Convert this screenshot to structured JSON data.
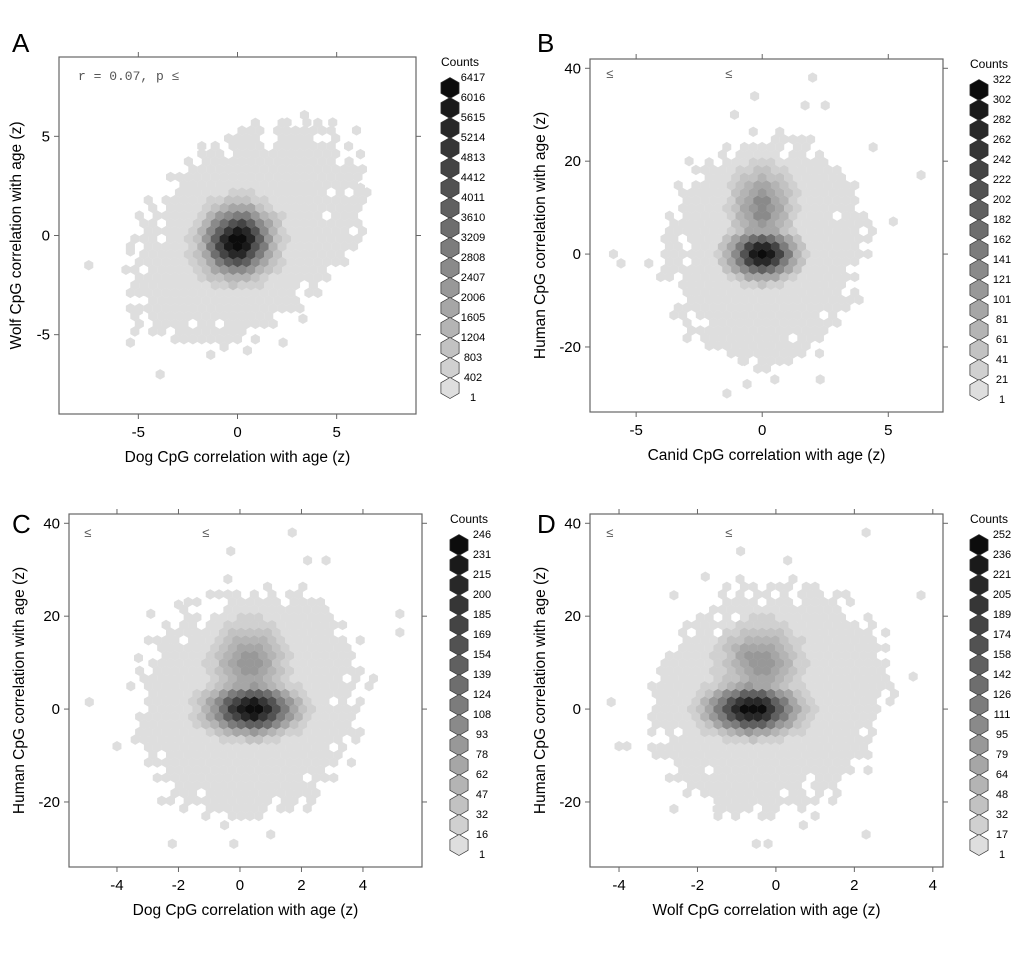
{
  "figure": {
    "panel_letters": [
      "A",
      "B",
      "C",
      "D"
    ]
  },
  "chart_data": [
    {
      "type": "hexbin",
      "panel": "A",
      "xlabel": "Dog CpG correlation with age (z)",
      "ylabel": "Wolf CpG correlation with age (z)",
      "xlim": [
        -9,
        9
      ],
      "ylim": [
        -9,
        9
      ],
      "xticks": [
        -5,
        0,
        5
      ],
      "yticks": [
        -5,
        0,
        5
      ],
      "annotations": [
        "r = 0.07, p ≤"
      ],
      "legend": {
        "title": "Counts",
        "position": "right",
        "levels": [
          6417,
          6016,
          5615,
          5214,
          4813,
          4412,
          4011,
          3610,
          3209,
          2808,
          2407,
          2006,
          1605,
          1204,
          803,
          402,
          1
        ]
      },
      "xbins": 40,
      "density": {
        "core": {
          "cx": 0,
          "cy": -0.3,
          "sx": 1.0,
          "sy": 1.0,
          "rho": 0.05,
          "peak": 6417
        },
        "halo": {
          "cx": 0.3,
          "cy": 0,
          "sx": 2.4,
          "sy": 2.3,
          "rho": 0.35
        },
        "extent_sigma": 2.3,
        "outliers": [
          [
            -7.5,
            -1.5
          ],
          [
            -5.4,
            -0.8
          ],
          [
            -5.4,
            -5.4
          ],
          [
            -5.0,
            -3.8
          ],
          [
            -4.7,
            -2.8
          ],
          [
            -3.9,
            -7.0
          ],
          [
            -1.8,
            4.5
          ],
          [
            2.5,
            5.7
          ],
          [
            3.5,
            5.7
          ],
          [
            4.8,
            5.7
          ],
          [
            5.6,
            4.5
          ],
          [
            6.0,
            5.3
          ],
          [
            6.2,
            4.1
          ],
          [
            6.2,
            2.4
          ],
          [
            2.3,
            -5.4
          ],
          [
            0.5,
            -5.8
          ],
          [
            3.3,
            -4.2
          ]
        ]
      }
    },
    {
      "type": "hexbin",
      "panel": "B",
      "xlabel": "Canid CpG correlation with age (z)",
      "ylabel": "Human CpG correlation with age (z)",
      "xlim": [
        -6.83,
        7.17
      ],
      "ylim": [
        -34,
        42
      ],
      "xticks": [
        -5,
        0,
        5
      ],
      "yticks": [
        -20,
        0,
        20,
        40
      ],
      "annotations": [
        "≤",
        "≤"
      ],
      "legend": {
        "title": "Counts",
        "position": "right",
        "levels": [
          322,
          302,
          282,
          262,
          242,
          222,
          202,
          182,
          162,
          141,
          121,
          101,
          81,
          61,
          41,
          21,
          1
        ]
      },
      "xbins": 40,
      "density": {
        "core": {
          "cx": 0,
          "cy": 0,
          "sx": 0.75,
          "sy": 3.0,
          "rho": 0.0,
          "peak": 322
        },
        "plume": {
          "cx": 0,
          "cy": 10,
          "sx": 0.7,
          "sy": 5,
          "weight": 0.35
        },
        "halo": {
          "cx": 0.2,
          "cy": 1,
          "sx": 1.7,
          "sy": 11,
          "rho": 0.1
        },
        "extent_sigma": 2.3,
        "outliers": [
          [
            -5.9,
            0
          ],
          [
            -5.6,
            -2
          ],
          [
            -4.5,
            -2
          ],
          [
            -2.9,
            20
          ],
          [
            -2.3,
            13
          ],
          [
            2,
            38
          ],
          [
            1.7,
            32
          ],
          [
            2.5,
            32
          ],
          [
            -1.1,
            30
          ],
          [
            -0.3,
            34
          ],
          [
            4.4,
            23
          ],
          [
            6.3,
            17
          ],
          [
            5.2,
            7
          ],
          [
            -1.4,
            -30
          ],
          [
            -0.6,
            -28
          ],
          [
            0.5,
            -27
          ],
          [
            2.3,
            -27
          ],
          [
            -0.8,
            -23
          ]
        ]
      }
    },
    {
      "type": "hexbin",
      "panel": "C",
      "xlabel": "Dog CpG correlation with age (z)",
      "ylabel": "Human CpG correlation with age (z)",
      "xlim": [
        -5.56,
        5.92
      ],
      "ylim": [
        -34,
        42
      ],
      "xticks": [
        -4,
        -2,
        0,
        2,
        4
      ],
      "yticks": [
        -20,
        0,
        20,
        40
      ],
      "annotations": [
        "≤",
        "≤"
      ],
      "legend": {
        "title": "Counts",
        "position": "right",
        "levels": [
          246,
          231,
          215,
          200,
          185,
          169,
          154,
          139,
          124,
          108,
          93,
          78,
          62,
          47,
          32,
          16,
          1
        ]
      },
      "xbins": 40,
      "density": {
        "core": {
          "cx": 0.4,
          "cy": 0,
          "sx": 0.8,
          "sy": 3.0,
          "rho": 0.0,
          "peak": 246
        },
        "plume": {
          "cx": 0.3,
          "cy": 10,
          "sx": 0.7,
          "sy": 5,
          "weight": 0.3
        },
        "halo": {
          "cx": 0.3,
          "cy": 1,
          "sx": 1.6,
          "sy": 11,
          "rho": 0.1
        },
        "extent_sigma": 2.3,
        "outliers": [
          [
            -4.9,
            1.5
          ],
          [
            -4.0,
            -8
          ],
          [
            -3.3,
            11
          ],
          [
            -2.9,
            20.5
          ],
          [
            -2.0,
            22.5
          ],
          [
            1.7,
            38
          ],
          [
            2.8,
            32
          ],
          [
            2.2,
            32
          ],
          [
            -0.3,
            34
          ],
          [
            5.2,
            20.5
          ],
          [
            5.2,
            16.5
          ],
          [
            -2.2,
            -29
          ],
          [
            -0.2,
            -29
          ],
          [
            1.0,
            -27
          ],
          [
            2.3,
            -19.5
          ],
          [
            -0.5,
            -25
          ],
          [
            0.8,
            -10
          ]
        ]
      }
    },
    {
      "type": "hexbin",
      "panel": "D",
      "xlabel": "Wolf CpG correlation with age (z)",
      "ylabel": "Human CpG correlation with age (z)",
      "xlim": [
        -4.74,
        4.26
      ],
      "ylim": [
        -34,
        42
      ],
      "xticks": [
        -4,
        -2,
        0,
        2,
        4
      ],
      "yticks": [
        -20,
        0,
        20,
        40
      ],
      "annotations": [
        "≤",
        "≤"
      ],
      "legend": {
        "title": "Counts",
        "position": "right",
        "levels": [
          252,
          236,
          221,
          205,
          189,
          174,
          158,
          142,
          126,
          111,
          95,
          79,
          64,
          48,
          32,
          17,
          1
        ]
      },
      "xbins": 40,
      "density": {
        "core": {
          "cx": -0.6,
          "cy": 0,
          "sx": 0.65,
          "sy": 3.0,
          "rho": 0.0,
          "peak": 252
        },
        "plume": {
          "cx": -0.4,
          "cy": 10,
          "sx": 0.6,
          "sy": 5,
          "weight": 0.3
        },
        "halo": {
          "cx": -0.1,
          "cy": 2,
          "sx": 1.3,
          "sy": 11,
          "rho": 0.1
        },
        "extent_sigma": 2.3,
        "outliers": [
          [
            -4.2,
            1.5
          ],
          [
            -3.8,
            -8
          ],
          [
            -2.6,
            24.5
          ],
          [
            -1.8,
            28.5
          ],
          [
            2.3,
            38
          ],
          [
            0.3,
            32
          ],
          [
            -0.9,
            34
          ],
          [
            3.7,
            24.5
          ],
          [
            3.5,
            7
          ],
          [
            -2.6,
            -21.5
          ],
          [
            -1.5,
            -21.5
          ],
          [
            -0.5,
            -29
          ],
          [
            -0.2,
            -29
          ],
          [
            2.3,
            -27
          ],
          [
            1.0,
            -23
          ],
          [
            0.7,
            -25
          ],
          [
            -4.0,
            -8
          ]
        ]
      }
    }
  ]
}
